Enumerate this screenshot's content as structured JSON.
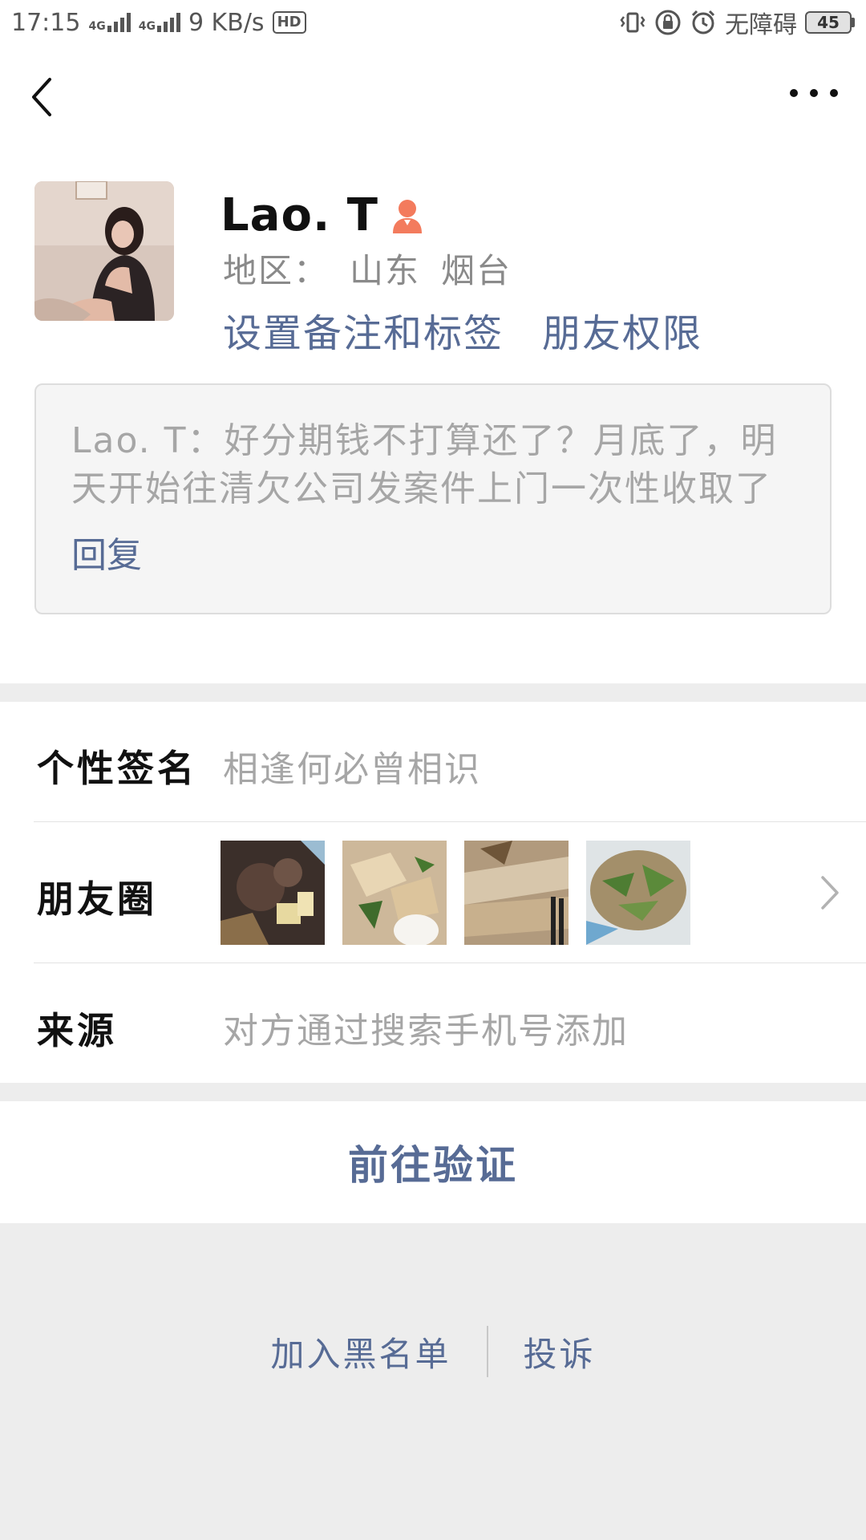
{
  "status_bar": {
    "time": "17:15",
    "signal_1": "4G",
    "signal_2": "4G",
    "speed": "9 KB/s",
    "hd_label": "HD",
    "accessibility": "无障碍",
    "battery": "45"
  },
  "profile": {
    "name": "Lao. T",
    "region_label": "地区：",
    "region_province": "山东",
    "region_city": "烟台",
    "remark_link": "设置备注和标签",
    "permission_link": "朋友权限",
    "greeting": "Lao. T：好分期钱不打算还了？月底了，明天开始往清欠公司发案件上门一次性收取了",
    "reply_label": "回复"
  },
  "info": {
    "signature_label": "个性签名",
    "signature_value": "相逢何必曾相识",
    "moments_label": "朋友圈",
    "source_label": "来源",
    "source_value": "对方通过搜索手机号添加"
  },
  "actions": {
    "verify_label": "前往验证",
    "blacklist_label": "加入黑名单",
    "report_label": "投诉"
  },
  "colors": {
    "link": "#576b95",
    "background": "#ededed"
  }
}
